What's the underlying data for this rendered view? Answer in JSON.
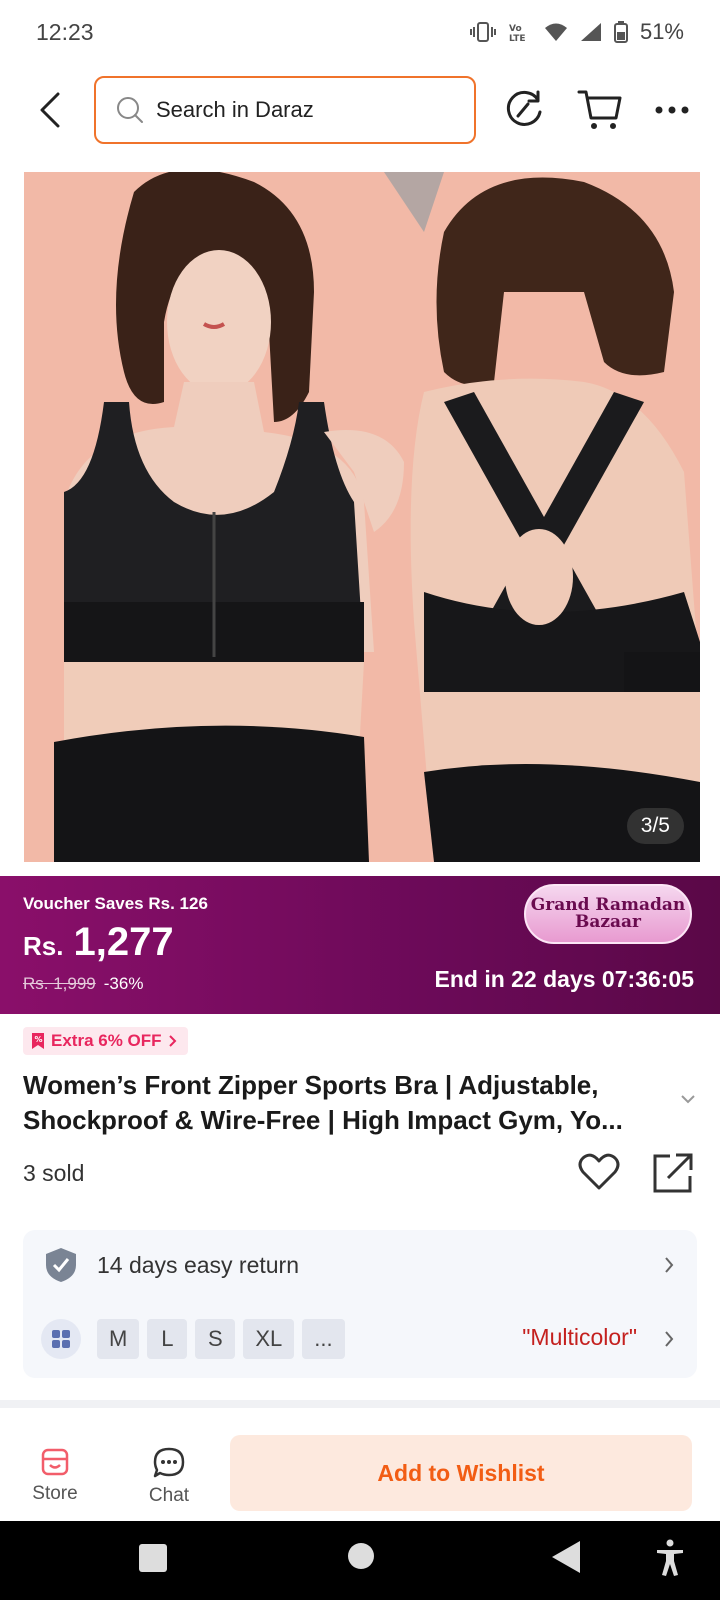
{
  "status_bar": {
    "time": "12:23",
    "battery": "51%",
    "icons": [
      "vibrate-icon",
      "volte-icon",
      "wifi-icon",
      "signal-icon",
      "battery-icon"
    ]
  },
  "header": {
    "search_placeholder": "Search in Daraz",
    "icons": [
      "back-icon",
      "search-icon",
      "refresh-icon",
      "cart-icon",
      "more-icon"
    ]
  },
  "gallery": {
    "counter": "3/5"
  },
  "price_banner": {
    "voucher": "Voucher Saves Rs. 126",
    "currency": "Rs.",
    "price": "1,277",
    "old_price": "Rs. 1,999",
    "discount": "-36%",
    "promo_line1": "Grand Ramadan",
    "promo_line2": "Bazaar",
    "countdown": "End in 22 days 07:36:05",
    "colors": {
      "start": "#8a0f6a",
      "end": "#5a0847"
    }
  },
  "extra_off": {
    "label": "Extra 6% OFF"
  },
  "product": {
    "title": "Women’s Front Zipper Sports Bra | Adjustable, Shockproof & Wire-Free | High Impact Gym, Yo...",
    "sold": "3 sold"
  },
  "service": {
    "return_text": "14 days easy return",
    "sizes": [
      "M",
      "L",
      "S",
      "XL",
      "..."
    ],
    "color_value": "\"Multicolor\""
  },
  "actions": {
    "store_label": "Store",
    "chat_label": "Chat",
    "wishlist_label": "Add to Wishlist",
    "accent": "#f25d14"
  },
  "nav": {
    "icons": [
      "recents-icon",
      "home-icon",
      "back-nav-icon",
      "accessibility-icon"
    ]
  }
}
